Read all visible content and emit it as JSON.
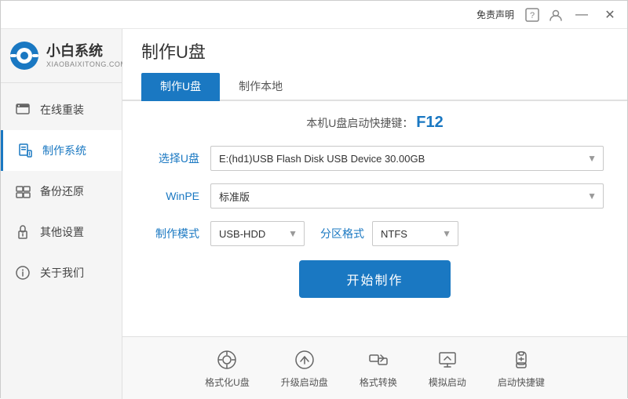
{
  "titleBar": {
    "freeText": "免责声明",
    "minimizeBtn": "—",
    "closeBtn": "✕"
  },
  "logo": {
    "title": "小白系统",
    "subtitle": "XIAOBAIXITONG.COM"
  },
  "sidebar": {
    "items": [
      {
        "id": "online-reinstall",
        "label": "在线重装",
        "icon": "⊡"
      },
      {
        "id": "make-system",
        "label": "制作系统",
        "icon": "💾",
        "active": true
      },
      {
        "id": "backup-restore",
        "label": "备份还原",
        "icon": "⊞"
      },
      {
        "id": "other-settings",
        "label": "其他设置",
        "icon": "🔒"
      },
      {
        "id": "about-us",
        "label": "关于我们",
        "icon": "ℹ"
      }
    ]
  },
  "pageTitle": "制作U盘",
  "tabs": [
    {
      "id": "make-udisk",
      "label": "制作U盘",
      "active": true
    },
    {
      "id": "make-local",
      "label": "制作本地"
    }
  ],
  "shortcutHint": {
    "prefix": "本机U盘启动快捷键：",
    "key": "F12"
  },
  "form": {
    "selectUDisk": {
      "label": "选择U盘",
      "value": "E:(hd1)USB Flash Disk USB Device 30.00GB"
    },
    "winpe": {
      "label": "WinPE",
      "value": "标准版"
    },
    "makeMode": {
      "label": "制作模式",
      "value": "USB-HDD"
    },
    "partitionFormat": {
      "label": "分区格式",
      "value": "NTFS"
    },
    "startBtn": "开始制作"
  },
  "bottomTools": [
    {
      "id": "format-udisk",
      "label": "格式化U盘",
      "icon": "⊙"
    },
    {
      "id": "upgrade-boot",
      "label": "升级启动盘",
      "icon": "⊕"
    },
    {
      "id": "format-convert",
      "label": "格式转换",
      "icon": "⇄"
    },
    {
      "id": "simulate-boot",
      "label": "模拟启动",
      "icon": "⊣"
    },
    {
      "id": "boot-shortcut",
      "label": "启动快捷键",
      "icon": "🔓"
    }
  ]
}
